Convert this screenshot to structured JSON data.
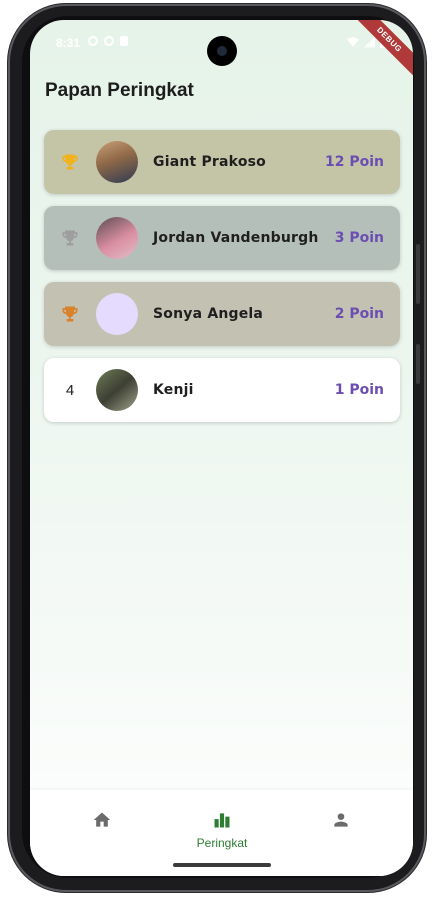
{
  "status_bar": {
    "time": "8:31"
  },
  "debug_banner": "DEBUG",
  "page": {
    "title": "Papan Peringkat"
  },
  "leaderboard": [
    {
      "rank": "1",
      "rank_style": "gold-trophy",
      "name": "Giant Prakoso",
      "points": "12 Poin",
      "row_color": "#c4c4a6"
    },
    {
      "rank": "2",
      "rank_style": "silver-trophy",
      "name": "Jordan Vandenburgh",
      "points": "3 Poin",
      "row_color": "#b5bfb9"
    },
    {
      "rank": "3",
      "rank_style": "bronze-trophy",
      "name": "Sonya Angela",
      "points": "2 Poin",
      "row_color": "#c3c1b1"
    },
    {
      "rank": "4",
      "rank_style": "number",
      "name": "Kenji",
      "points": "1 Poin",
      "row_color": "#ffffff"
    }
  ],
  "bottom_nav": {
    "items": [
      {
        "icon": "home-icon",
        "label": ""
      },
      {
        "icon": "leaderboard-icon",
        "label": "Peringkat",
        "active": true
      },
      {
        "icon": "person-icon",
        "label": ""
      }
    ]
  },
  "colors": {
    "accent_points": "#6c4eb3",
    "nav_active": "#2e7d32",
    "trophy_gold": "#f2b21a",
    "trophy_silver": "#9e9e9e",
    "trophy_bronze": "#d9822b"
  }
}
